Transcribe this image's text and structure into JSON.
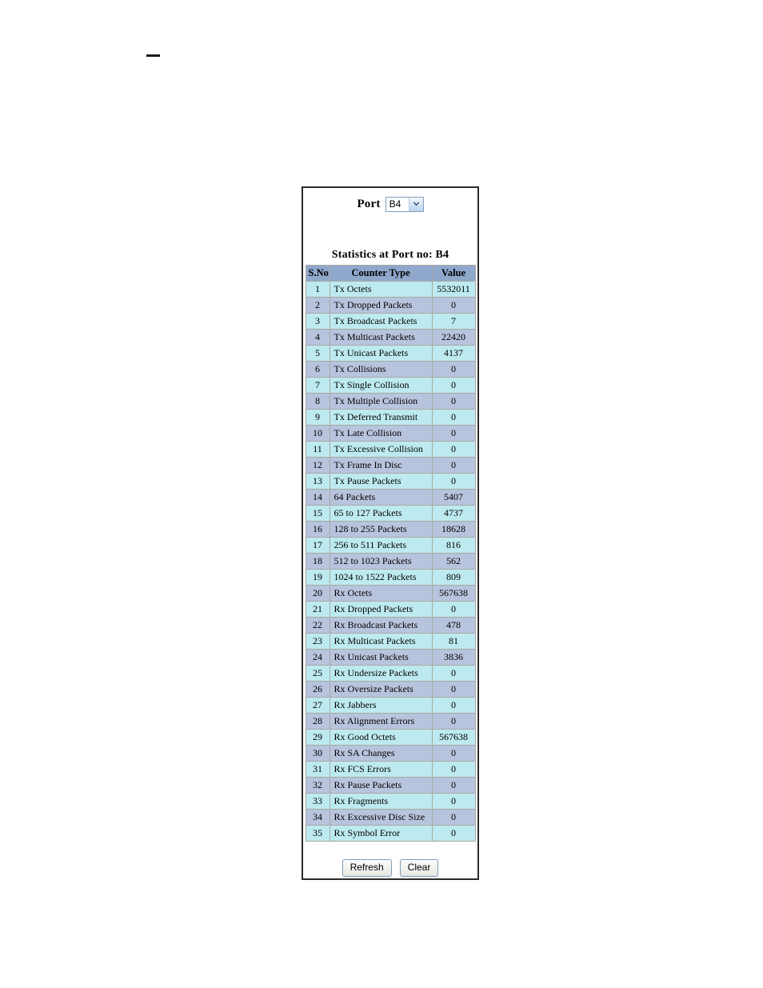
{
  "page": {
    "dash_mark": "-"
  },
  "panel": {
    "port_selector": {
      "label": "Port",
      "selected": "B4",
      "options": [
        "B4"
      ],
      "arrow_icon": "chevron-down-icon"
    },
    "stats_title": "Statistics at Port no:  B4",
    "table": {
      "headers": [
        "S.No",
        "Counter Type",
        "Value"
      ],
      "rows": [
        {
          "sno": "1",
          "type": "Tx Octets",
          "value": "5532011"
        },
        {
          "sno": "2",
          "type": "Tx Dropped Packets",
          "value": "0"
        },
        {
          "sno": "3",
          "type": "Tx Broadcast Packets",
          "value": "7"
        },
        {
          "sno": "4",
          "type": "Tx Multicast Packets",
          "value": "22420"
        },
        {
          "sno": "5",
          "type": "Tx Unicast Packets",
          "value": "4137"
        },
        {
          "sno": "6",
          "type": "Tx Collisions",
          "value": "0"
        },
        {
          "sno": "7",
          "type": "Tx Single Collision",
          "value": "0"
        },
        {
          "sno": "8",
          "type": "Tx Multiple Collision",
          "value": "0"
        },
        {
          "sno": "9",
          "type": "Tx Deferred Transmit",
          "value": "0"
        },
        {
          "sno": "10",
          "type": "Tx Late Collision",
          "value": "0"
        },
        {
          "sno": "11",
          "type": "Tx Excessive Collision",
          "value": "0"
        },
        {
          "sno": "12",
          "type": "Tx Frame In Disc",
          "value": "0"
        },
        {
          "sno": "13",
          "type": "Tx Pause Packets",
          "value": "0"
        },
        {
          "sno": "14",
          "type": "64 Packets",
          "value": "5407"
        },
        {
          "sno": "15",
          "type": "65 to 127 Packets",
          "value": "4737"
        },
        {
          "sno": "16",
          "type": "128 to 255 Packets",
          "value": "18628"
        },
        {
          "sno": "17",
          "type": "256 to 511 Packets",
          "value": "816"
        },
        {
          "sno": "18",
          "type": "512 to 1023 Packets",
          "value": "562"
        },
        {
          "sno": "19",
          "type": "1024 to 1522 Packets",
          "value": "809"
        },
        {
          "sno": "20",
          "type": "Rx Octets",
          "value": "567638"
        },
        {
          "sno": "21",
          "type": "Rx Dropped Packets",
          "value": "0"
        },
        {
          "sno": "22",
          "type": "Rx Broadcast Packets",
          "value": "478"
        },
        {
          "sno": "23",
          "type": "Rx Multicast Packets",
          "value": "81"
        },
        {
          "sno": "24",
          "type": "Rx Unicast Packets",
          "value": "3836"
        },
        {
          "sno": "25",
          "type": "Rx Undersize Packets",
          "value": "0"
        },
        {
          "sno": "26",
          "type": "Rx Oversize Packets",
          "value": "0"
        },
        {
          "sno": "27",
          "type": "Rx Jabbers",
          "value": "0"
        },
        {
          "sno": "28",
          "type": "Rx Alignment Errors",
          "value": "0"
        },
        {
          "sno": "29",
          "type": "Rx Good Octets",
          "value": "567638"
        },
        {
          "sno": "30",
          "type": "Rx SA Changes",
          "value": "0"
        },
        {
          "sno": "31",
          "type": "Rx FCS Errors",
          "value": "0"
        },
        {
          "sno": "32",
          "type": "Rx Pause Packets",
          "value": "0"
        },
        {
          "sno": "33",
          "type": "Rx Fragments",
          "value": "0"
        },
        {
          "sno": "34",
          "type": "Rx Excessive Disc Size",
          "value": "0"
        },
        {
          "sno": "35",
          "type": "Rx Symbol Error",
          "value": "0"
        }
      ]
    },
    "buttons": {
      "refresh": "Refresh",
      "clear": "Clear"
    }
  },
  "colors": {
    "header_bg": "#8fa8cc",
    "row_odd_bg": "#bdeaf0",
    "row_even_bg": "#b8c4dd",
    "cell_border": "#a8a8a0",
    "panel_border": "#2b2b2b"
  }
}
